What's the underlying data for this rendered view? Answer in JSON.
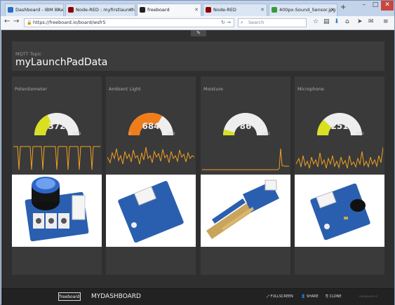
{
  "tabs": [
    {
      "label": "Dashboard - IBM Bluemix",
      "active": false,
      "color": "#2a6ebb"
    },
    {
      "label": "Node-RED : myfirstlaunchpa...",
      "active": false,
      "color": "#8f0000"
    },
    {
      "label": "freeboard",
      "active": true,
      "color": "#222222"
    },
    {
      "label": "Node-RED",
      "active": false,
      "color": "#8f0000"
    },
    {
      "label": "400px-Sound_Sensor.jpg ...",
      "active": false,
      "color": "#3a9a3a"
    }
  ],
  "url": "https://freeboard.io/board/wsfr5",
  "search_placeholder": "Search",
  "topic": {
    "label": "MQTT Topic",
    "value": "myLaunchPadData"
  },
  "cards": [
    {
      "title": "Potentiometer",
      "value": "372",
      "min": "0",
      "max": "1023",
      "fraction": 0.364,
      "color": "#d9e021",
      "photo_icon": "potentiometer-photo"
    },
    {
      "title": "Ambient Light",
      "value": "684",
      "min": "0",
      "max": "1023",
      "fraction": 0.669,
      "color": "#f07d1a",
      "photo_icon": "light-sensor-photo"
    },
    {
      "title": "Moisture",
      "value": "86",
      "min": "0",
      "max": "1023",
      "fraction": 0.084,
      "color": "#d9e021",
      "photo_icon": "moisture-sensor-photo"
    },
    {
      "title": "Microphone",
      "value": "251",
      "min": "0",
      "max": "1023",
      "fraction": 0.245,
      "color": "#d9e021",
      "photo_icon": "sound-sensor-photo"
    }
  ],
  "bottombar": {
    "logo": "freeboard",
    "dashboard_name": "MYDASHBOARD",
    "fullscreen": "FULLSCREEN",
    "share": "SHARE",
    "clone": "CLONE",
    "powered": "FREEBOARD.IO"
  }
}
